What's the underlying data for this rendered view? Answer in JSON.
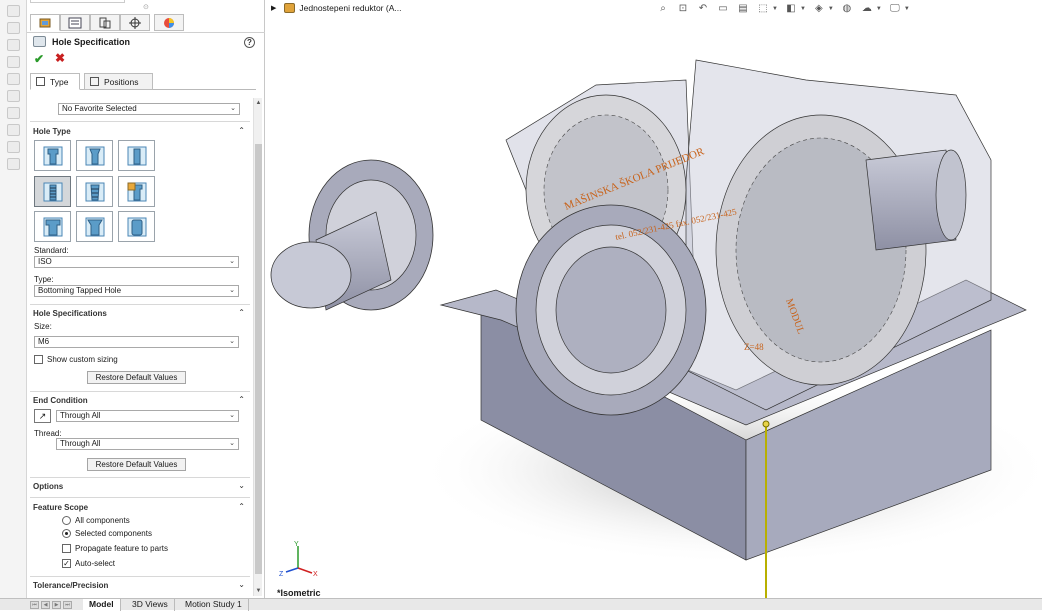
{
  "panel": {
    "title": "Hole Specification",
    "help_label": "?",
    "tabs": {
      "type": "Type",
      "positions": "Positions"
    },
    "favorite": "No Favorite Selected",
    "hole_type": {
      "header": "Hole Type",
      "options": [
        "counterbore",
        "countersink",
        "hole",
        "straight-tap",
        "tapered-tap",
        "legacy",
        "counterbore-slot",
        "countersink-slot",
        "slot"
      ],
      "selected": "straight-tap"
    },
    "standard": {
      "label": "Standard:",
      "value": "ISO"
    },
    "type": {
      "label": "Type:",
      "value": "Bottoming Tapped Hole"
    },
    "hole_specs": {
      "header": "Hole Specifications",
      "size_label": "Size:",
      "size_value": "M6",
      "custom_sizing": "Show custom sizing",
      "restore": "Restore Default Values"
    },
    "end_condition": {
      "header": "End Condition",
      "value": "Through All",
      "thread_label": "Thread:",
      "thread_value": "Through All",
      "restore": "Restore Default Values"
    },
    "options": {
      "header": "Options"
    },
    "feature_scope": {
      "header": "Feature Scope",
      "all_components": "All components",
      "selected_components": "Selected components",
      "propagate": "Propagate feature to parts",
      "auto_select": "Auto-select",
      "selected": "selected_components",
      "propagate_checked": false,
      "auto_select_checked": true
    },
    "tolerance": {
      "header": "Tolerance/Precision"
    }
  },
  "viewport": {
    "assembly_name": "Jednostepeni reduktor  (A...",
    "view_name": "*Isometric",
    "engraving_text": "MAŠINSKA ŠKOLA PRIJEDOR",
    "engraving_text_2": "tel. 052/231-425 fax. 052/231-425",
    "engraving_text_3": "MODUL",
    "engraving_text_4": "Z=48",
    "axes": {
      "x": "X",
      "y": "Y",
      "z": "Z"
    }
  },
  "bottom_tabs": [
    "Model",
    "3D Views",
    "Motion Study 1"
  ],
  "colors": {
    "housing": "#a9acbf",
    "gear": "#c9c9c9",
    "shaft": "#b2b4c6",
    "engrave": "#c8631b"
  }
}
